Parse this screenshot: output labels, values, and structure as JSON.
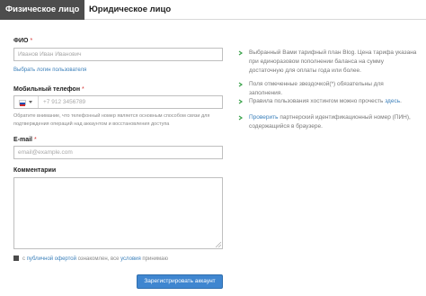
{
  "tabs": [
    {
      "label": "Физическое лицо"
    },
    {
      "label": "Юридическое лицо"
    }
  ],
  "form": {
    "fio": {
      "label": "ФИО",
      "required_mark": "*",
      "placeholder": "Иванов Иван Иванович"
    },
    "choose_login_link": "Выбрать логин пользователя",
    "phone": {
      "label": "Мобильный телефон",
      "required_mark": "*",
      "placeholder": "+7 912 3456789",
      "hint": "Обратите внимание, что телефонный номер является основным способом связи для подтверждения операций над аккаунтом и восстановления доступа"
    },
    "email": {
      "label": "E-mail",
      "required_mark": "*",
      "placeholder": "email@example.com"
    },
    "comments": {
      "label": "Комментарии"
    },
    "agree": {
      "text_before": "с ",
      "offer_link": "публичной офертой",
      "text_middle": " ознакомлен, все ",
      "terms_link": "условия",
      "text_after": " принимаю"
    },
    "submit_label": "Зарегистрировать аккаунт"
  },
  "info": {
    "plan": {
      "text_before": "Выбранный Вами тарифный план ",
      "plan_name": "Blog",
      "text_after": ". Цена тарифа указана при единоразовом пополнении баланса на сумму достаточную для оплаты года или более."
    },
    "required_note": "Поля отмеченные звездочкой(*) обязательны для заполнения.",
    "rules": {
      "text_before": "Правила пользования хостингом можно прочесть ",
      "link": "здесь",
      "text_after": "."
    },
    "check_id": {
      "link": "Проверить",
      "text_after": " партнерский идентификационный номер (ПИН), содержащийся в браузере."
    }
  },
  "colors": {
    "accent": "#3f86d0",
    "link": "#3a7fba",
    "tab_active_bg": "#4d4d4d",
    "bullet": "#3aa24a",
    "required": "#d33333"
  },
  "icons": {
    "bullet": "check-icon",
    "flag": "russia-flag-icon",
    "caret": "chevron-down-icon"
  }
}
